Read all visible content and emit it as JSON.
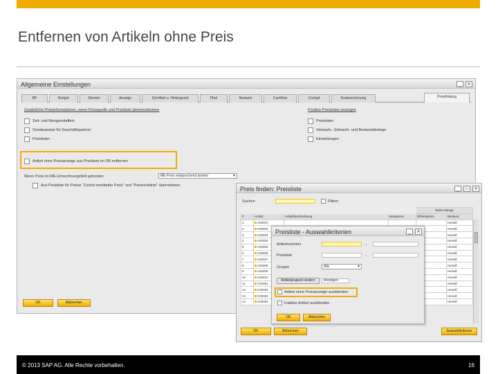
{
  "slide": {
    "title": "Entfernen von Artikeln ohne Preis",
    "footer": "© 2013 SAP AG. Alle Rechte vorbehalten.",
    "page_number": "16",
    "accent_color": "#f0ab00"
  },
  "main_window": {
    "title": "Allgemeine Einstellungen",
    "tabs": [
      "BP",
      "Budget",
      "Dienste",
      "Anzeige",
      "Schriftart u. Hintergrund",
      "Pfad",
      "Bestand",
      "Cashflow",
      "Cockpit",
      "Kostenrechnung",
      "Preisfindung"
    ],
    "selected_tab": "Preisfindung",
    "left_header": "Zusätzliche Preisinformationen, wenn Preisquelle und Preisliste übereinstimmen",
    "left_options": [
      "Zeit- und Mengenstaffeln",
      "Sonderpreise für Geschäftspartner",
      "Preislisten"
    ],
    "right_header": "Positive Preislisten anzeigen",
    "right_options": [
      "Preislisten",
      "Verkaufs-, Einkaufs- und Bestandsbelege",
      "Einstellungen"
    ],
    "highlight_option": "Artikel ohne Preisanzeige aus Preisliste im DB entfernen",
    "bottom_label": "Wenn Preis im ME-Umrechnungsfeld gefunden",
    "bottom_select": "ME-Preis entsprechend ändern",
    "bottom_check_label": "Aus Preisliste für Preise \"Zuletzt ermittelter Preis\" und \"Preisrichtlinie\" übernehmen",
    "ok_label": "OK",
    "cancel_label": "Abbrechen"
  },
  "price_window": {
    "title": "Preis finden: Preisliste",
    "search_label": "Suchen",
    "filter_label": "Filtern",
    "group_header": "Basis-Menge",
    "columns": [
      "#",
      "Artikel",
      "Artikelbeschreibung",
      "Basispreis",
      "Effektivpreis",
      "Bestand"
    ],
    "rows": [
      {
        "n": "1",
        "item": "A00001",
        "desc": "",
        "base": "",
        "eff": "",
        "stock": "Herwill"
      },
      {
        "n": "2",
        "item": "A00002",
        "desc": "",
        "base": "",
        "eff": "",
        "stock": "Herwill"
      },
      {
        "n": "3",
        "item": "A00003",
        "desc": "",
        "base": "",
        "eff": "",
        "stock": "Herwill"
      },
      {
        "n": "4",
        "item": "A00004",
        "desc": "",
        "base": "",
        "eff": "",
        "stock": "Herwill"
      },
      {
        "n": "5",
        "item": "A00005",
        "desc": "",
        "base": "",
        "eff": "",
        "stock": "Herwill"
      },
      {
        "n": "6",
        "item": "A00006",
        "desc": "",
        "base": "",
        "eff": "",
        "stock": "Herwill"
      },
      {
        "n": "7",
        "item": "A00007",
        "desc": "",
        "base": "",
        "eff": "",
        "stock": "Herwill"
      },
      {
        "n": "8",
        "item": "A00008",
        "desc": "",
        "base": "",
        "eff": "",
        "stock": "Herwill"
      },
      {
        "n": "9",
        "item": "A00009",
        "desc": "",
        "base": "",
        "eff": "",
        "stock": "Herwill"
      },
      {
        "n": "10",
        "item": "A00010",
        "desc": "",
        "base": "",
        "eff": "",
        "stock": "Herwill"
      },
      {
        "n": "11",
        "item": "C00001",
        "desc": "",
        "base": "",
        "eff": "",
        "stock": "Herwill"
      },
      {
        "n": "12",
        "item": "C00002",
        "desc": "",
        "base": "",
        "eff": "",
        "stock": "Herwill"
      },
      {
        "n": "13",
        "item": "C00003",
        "desc": "",
        "base": "",
        "eff": "",
        "stock": "Herwill"
      },
      {
        "n": "14",
        "item": "C00004",
        "desc": "",
        "base": "",
        "eff": "",
        "stock": "Herwill"
      }
    ],
    "ok_label": "OK",
    "cancel_label": "Abbrechen",
    "select_label": "Auswahlkriterien"
  },
  "criteria_window": {
    "title": "Preisliste - Auswahlkriterien",
    "field1_label": "Artikelnummer",
    "field2_label": "Preisliste",
    "field3_label": "Gruppe",
    "field3_value": "Alle",
    "group_button": "Artikelgruppen ändern",
    "group_value": "Anzeigen",
    "highlight_option": "Artikel ohne Preisanzeige ausblenden",
    "extra_option": "Inaktive Artikel ausblenden",
    "ok_label": "OK",
    "cancel_label": "Abbrechen"
  }
}
